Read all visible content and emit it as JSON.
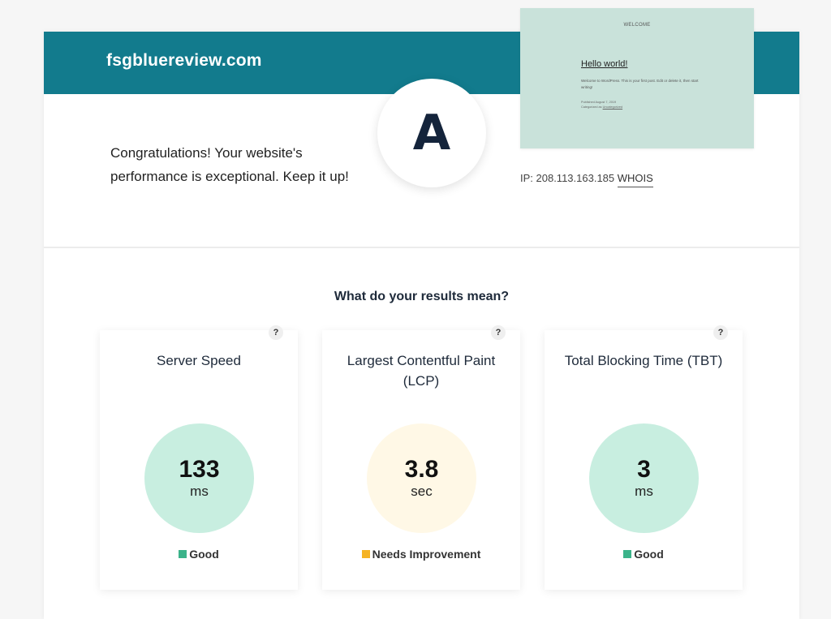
{
  "site": {
    "name": "fsgbluereview.com",
    "grade": "A",
    "message": "Congratulations! Your website's performance is exceptional. Keep it up!",
    "ip_label": "IP: 208.113.163.185",
    "whois_label": "WHOIS"
  },
  "preview": {
    "welcome": "WELCOME",
    "title": "Hello world!",
    "body": "Welcome to WordPress. This is your first post. Edit or delete it, then start writing!",
    "meta_line1": "Published August 7, 2019",
    "meta_prefix": "Categorized as ",
    "meta_link": "Uncategorized"
  },
  "results": {
    "heading": "What do your results mean?",
    "help_label": "?",
    "metrics": [
      {
        "title": "Server Speed",
        "value": "133",
        "unit": "ms",
        "status": "Good",
        "status_color": "#3bb38a",
        "ring_color": "#c8eee0"
      },
      {
        "title": "Largest Contentful Paint (LCP)",
        "value": "3.8",
        "unit": "sec",
        "status": "Needs Improvement",
        "status_color": "#f5b324",
        "ring_color": "#fff8e6"
      },
      {
        "title": "Total Blocking Time (TBT)",
        "value": "3",
        "unit": "ms",
        "status": "Good",
        "status_color": "#3bb38a",
        "ring_color": "#c8eee0"
      }
    ]
  },
  "colors": {
    "header": "#127b8d",
    "grade_text": "#14243b"
  }
}
